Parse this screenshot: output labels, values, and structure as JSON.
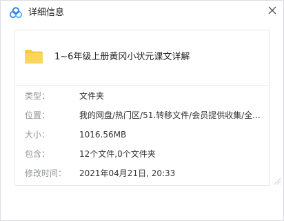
{
  "window": {
    "title": "详细信息",
    "app_icon": "cloud-icon",
    "close_icon": "close-icon"
  },
  "file": {
    "icon": "folder-icon",
    "name": "1~6年级上册黄冈小状元课文详解"
  },
  "details": [
    {
      "key": "type",
      "label": "类型：",
      "value": "文件夹"
    },
    {
      "key": "location",
      "label": "位置：",
      "value": "我的网盘/热门区/51.转移文件/会员提供收集/全..."
    },
    {
      "key": "size",
      "label": "大小：",
      "value": "1016.56MB"
    },
    {
      "key": "contains",
      "label": "包含：",
      "value": "12个文件,0个文件夹"
    },
    {
      "key": "modified",
      "label": "修改时间：",
      "value": "2021年04月21日, 20:33"
    }
  ],
  "colors": {
    "folder": "#f7c948",
    "brand_blue": "#4a90e2"
  }
}
